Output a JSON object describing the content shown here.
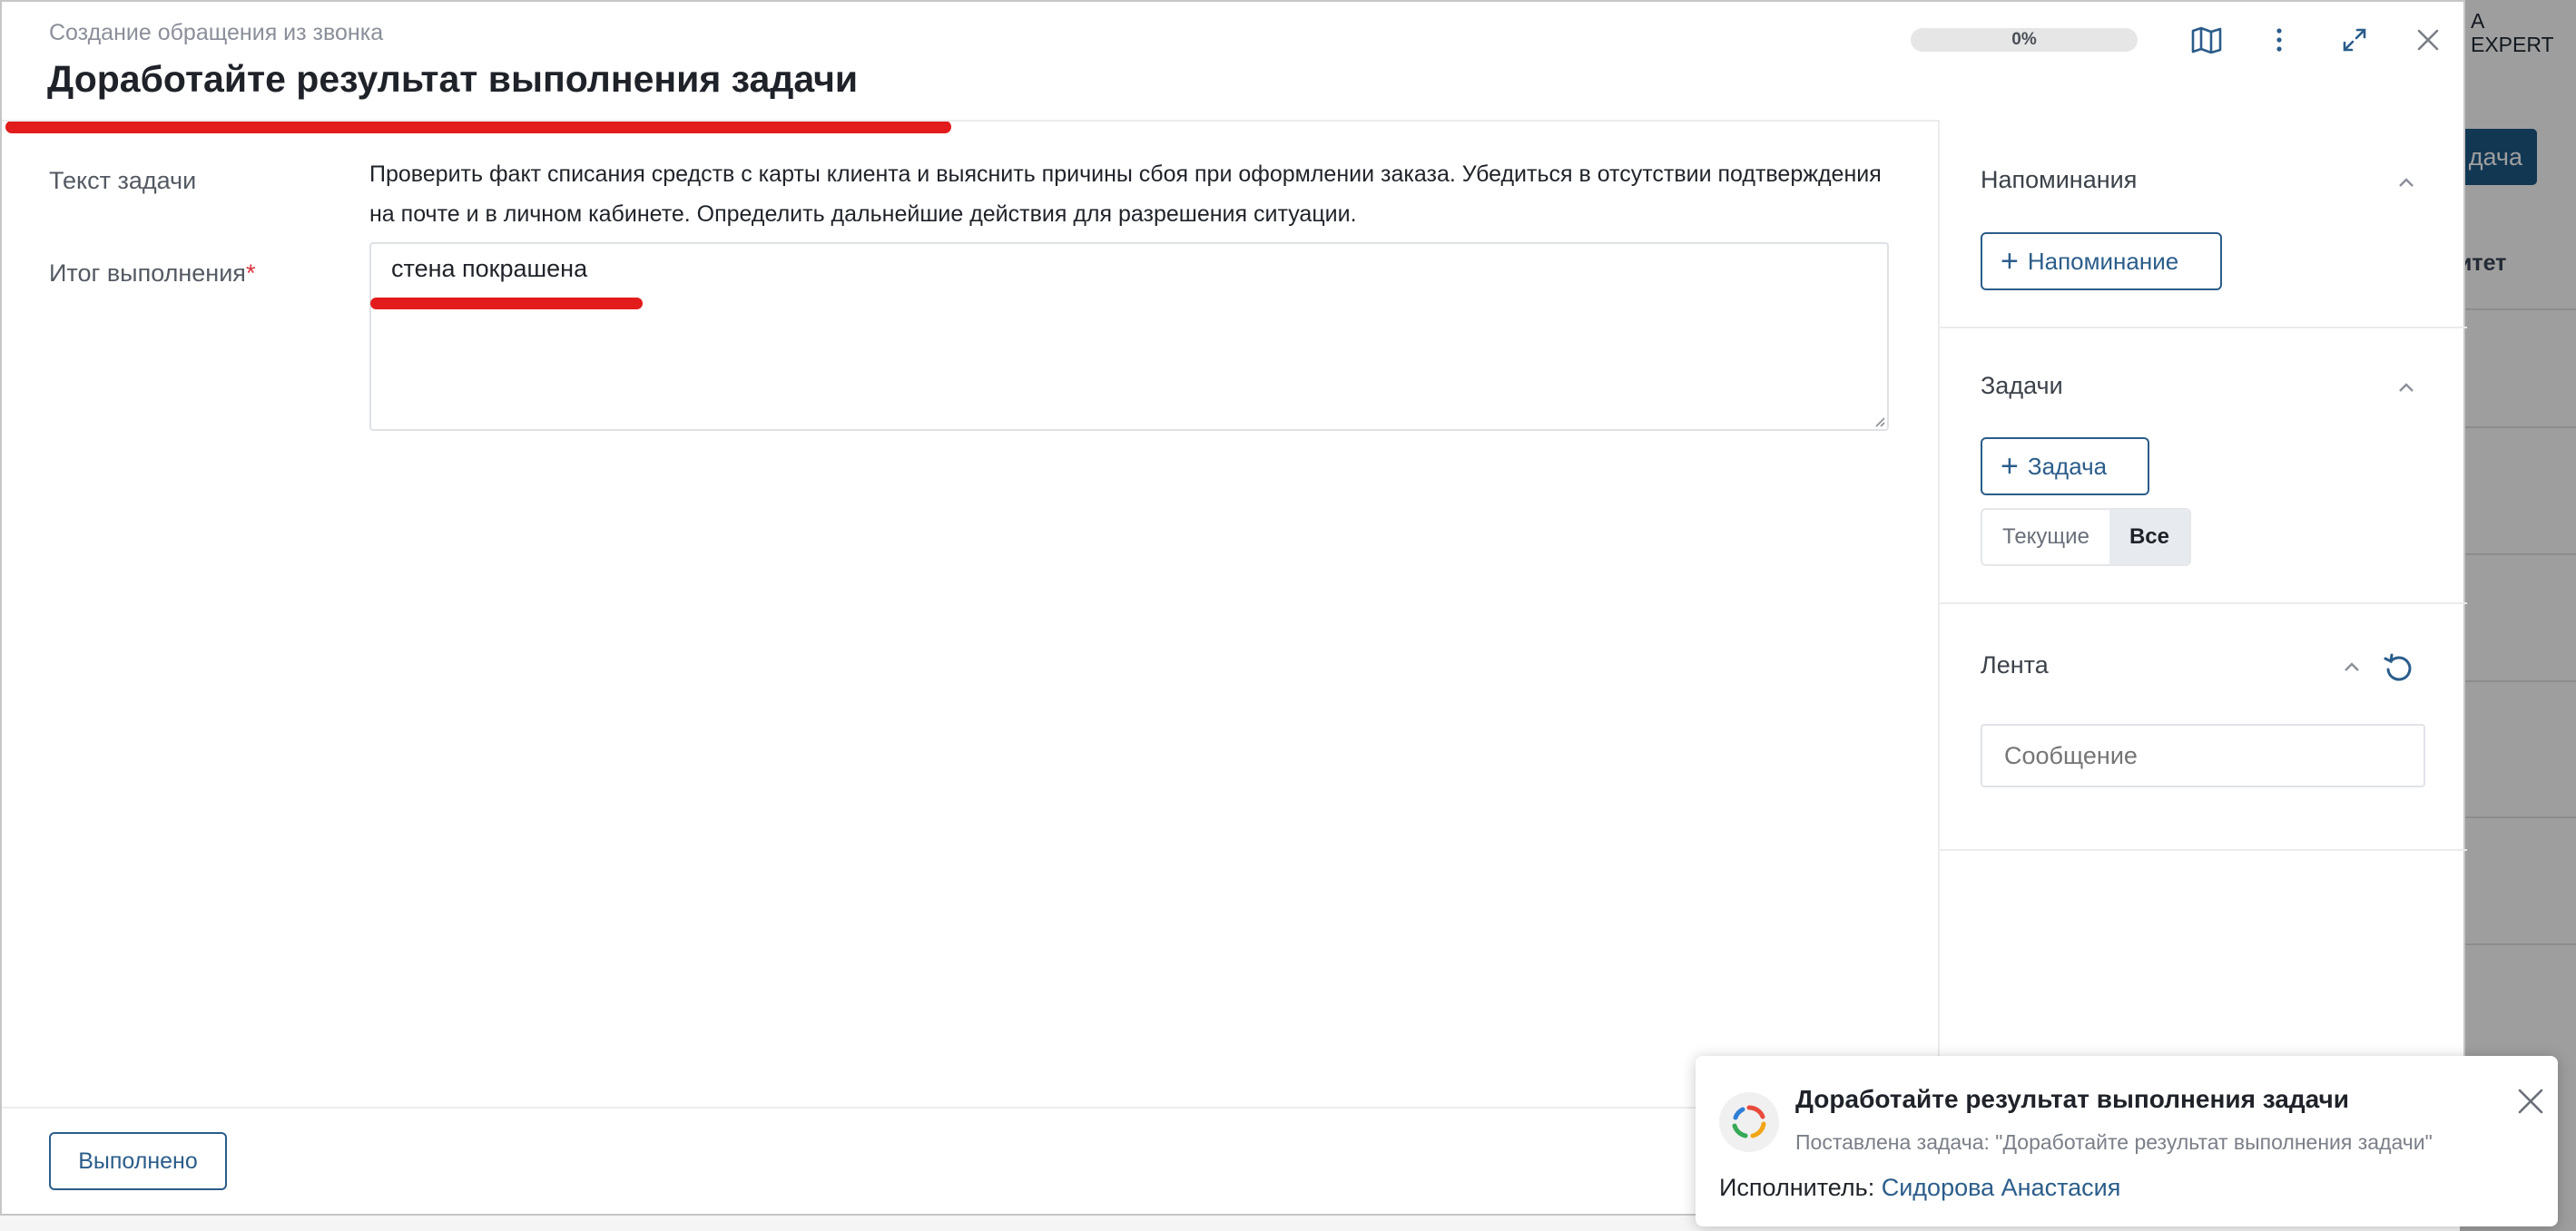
{
  "background": {
    "user_line1": "А",
    "user_line2": "EXPERT",
    "button_label": "дача",
    "column_header": "итет"
  },
  "modal": {
    "subtitle": "Создание обращения из звонка",
    "title": "Доработайте результат выполнения задачи",
    "progress": {
      "label": "0%",
      "value": 0
    },
    "task_label": "Текст задачи",
    "task_text": "Проверить факт списания средств с карты клиента и выяснить причины сбоя при оформлении заказа. Убедиться в отсутствии подтверждения на почте и в личном кабинете. Определить дальнейшие действия для разрешения ситуации.",
    "result_label": "Итог выполнения",
    "required_mark": "*",
    "result_value": "стена покрашена",
    "done_button": "Выполнено"
  },
  "sidebar": {
    "reminders": {
      "title": "Напоминания",
      "add_label": "Напоминание"
    },
    "tasks": {
      "title": "Задачи",
      "add_label": "Задача",
      "filter_current": "Текущие",
      "filter_all": "Все",
      "selected_filter": "Все"
    },
    "feed": {
      "title": "Лента",
      "message_placeholder": "Сообщение"
    }
  },
  "toast": {
    "title": "Доработайте результат выполнения задачи",
    "subtitle": "Поставлена задача: \"Доработайте результат выполнения задачи\"",
    "executor_label": "Исполнитель:",
    "executor_name": "Сидорова Анастасия"
  },
  "colors": {
    "accent": "#2b5d8a",
    "highlight_red": "#e21c1c",
    "required": "#d8323b"
  },
  "icons": {
    "map": "map-icon",
    "more": "more-vertical-icon",
    "expand": "expand-icon",
    "close": "close-icon",
    "chevron": "chevron-up-icon",
    "refresh": "refresh-icon",
    "logo": "app-logo-icon"
  }
}
